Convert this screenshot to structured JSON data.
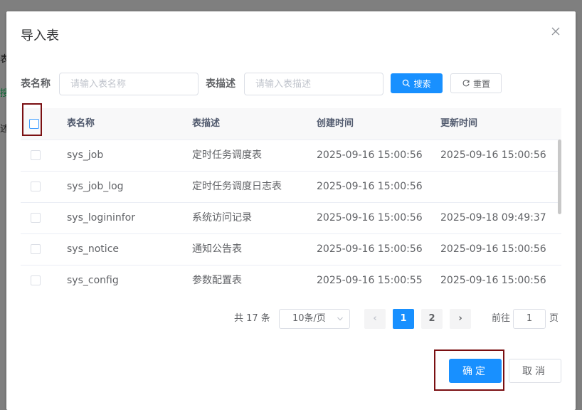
{
  "background": {
    "fragments": [
      "表",
      "搜",
      "述"
    ]
  },
  "dialog": {
    "title": "导入表",
    "close_glyph": "×"
  },
  "search": {
    "table_name_label": "表名称",
    "table_name_placeholder": "请输入表名称",
    "table_desc_label": "表描述",
    "table_desc_placeholder": "请输入表描述",
    "search_button": "搜索",
    "reset_button": "重置"
  },
  "table": {
    "columns": [
      "表名称",
      "表描述",
      "创建时间",
      "更新时间"
    ],
    "rows": [
      {
        "name": "sys_job",
        "desc": "定时任务调度表",
        "created": "2025-09-16 15:00:56",
        "updated": "2025-09-16 15:00:56"
      },
      {
        "name": "sys_job_log",
        "desc": "定时任务调度日志表",
        "created": "2025-09-16 15:00:56",
        "updated": ""
      },
      {
        "name": "sys_logininfor",
        "desc": "系统访问记录",
        "created": "2025-09-16 15:00:56",
        "updated": "2025-09-18 09:49:37"
      },
      {
        "name": "sys_notice",
        "desc": "通知公告表",
        "created": "2025-09-16 15:00:56",
        "updated": "2025-09-16 15:00:56"
      },
      {
        "name": "sys_config",
        "desc": "参数配置表",
        "created": "2025-09-16 15:00:55",
        "updated": "2025-09-16 15:00:56"
      }
    ]
  },
  "pagination": {
    "total": "共 17 条",
    "page_size": "10条/页",
    "pages": [
      "1",
      "2"
    ],
    "current_page": "1",
    "prev_glyph": "‹",
    "next_glyph": "›",
    "goto_label": "前往",
    "goto_value": "1",
    "page_word": "页"
  },
  "footer": {
    "confirm_button": "确定",
    "cancel_button": "取消"
  },
  "colors": {
    "primary": "#1890ff",
    "highlight": "#7a0f12",
    "overlay": "#808080"
  }
}
